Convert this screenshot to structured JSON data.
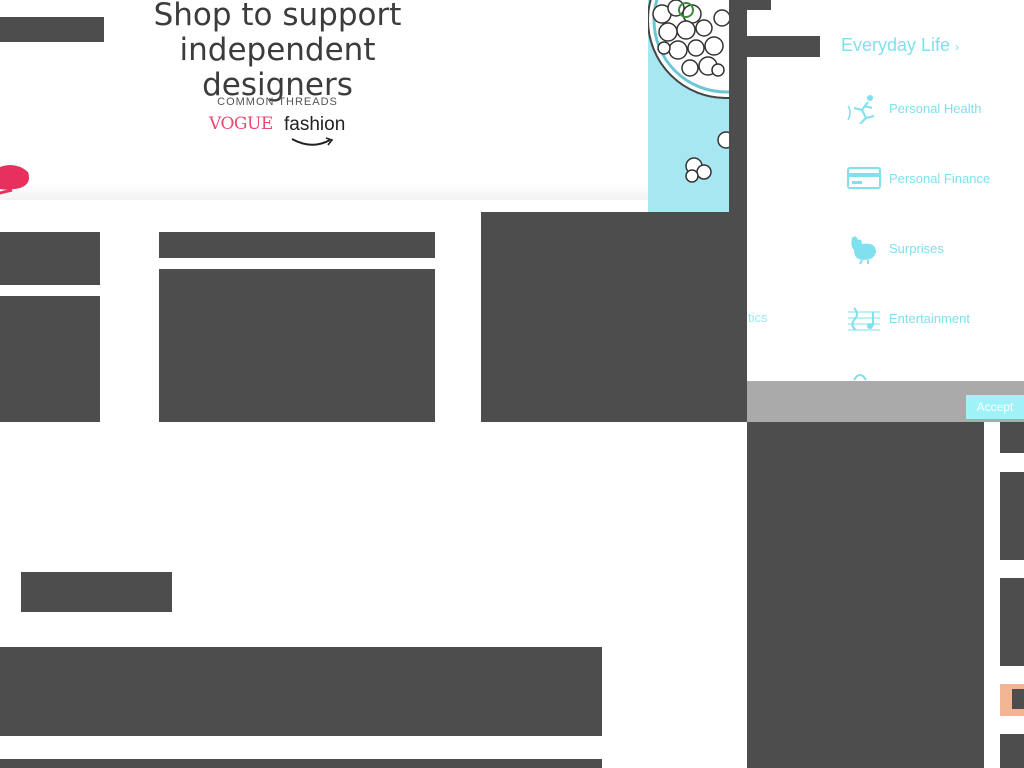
{
  "hero": {
    "title_line1": "Shop to support",
    "title_line2": "independent designers",
    "caption": "COMMON THREADS",
    "partner1": "VOGUE",
    "partner2": "fashion"
  },
  "panel": {
    "title": "Everyday Life",
    "title_suffix": "›",
    "items": [
      {
        "label": "Personal Health",
        "icon": "running-person-icon"
      },
      {
        "label": "Personal Finance",
        "icon": "credit-card-icon"
      },
      {
        "label": "Surprises",
        "icon": "chicken-icon"
      },
      {
        "label": "Entertainment",
        "icon": "music-note-icon"
      },
      {
        "label": "",
        "icon": "partial-icon"
      }
    ],
    "stray_text": "tics"
  },
  "cookie": {
    "accept_label": "Accept"
  },
  "colors": {
    "redaction": "#4d4d4d",
    "accent": "#7fe0ee",
    "cookie_bar": "#aaaaaa",
    "accept_bg": "#9ff2f8",
    "vogue": "#e8496f",
    "chip": "#f2b594"
  }
}
